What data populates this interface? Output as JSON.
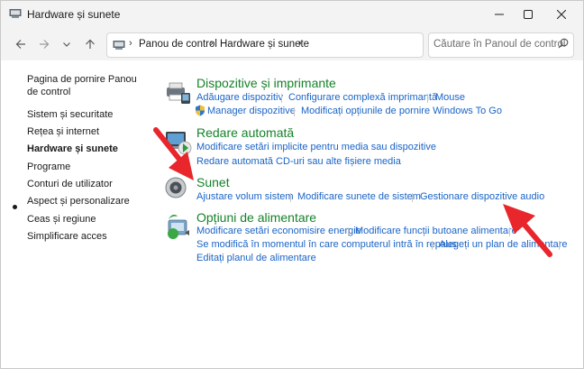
{
  "window": {
    "title": "Hardware și sunete"
  },
  "address": {
    "crumbs": [
      "Panou de control",
      "Hardware și sunete"
    ],
    "search_placeholder": "Căutare în Panoul de control"
  },
  "sidebar": {
    "items": [
      "Pagina de pornire Panou de control",
      "Sistem și securitate",
      "Rețea și internet",
      "Hardware și sunete",
      "Programe",
      "Conturi de utilizator",
      "Aspect și personalizare",
      "Ceas și regiune",
      "Simplificare acces"
    ],
    "active_index": 3
  },
  "categories": [
    {
      "title": "Dispozitive și imprimante",
      "links": [
        "Adăugare dispozitiv",
        "Configurare complexă imprimantă",
        "Mouse",
        "Manager dispozitive",
        "Modificați opțiunile de pornire Windows To Go"
      ]
    },
    {
      "title": "Redare automată",
      "links": [
        "Modificare setări implicite pentru media sau dispozitive",
        "Redare automată CD-uri sau alte fișiere media"
      ]
    },
    {
      "title": "Sunet",
      "links": [
        "Ajustare volum sistem",
        "Modificare sunete de sistem",
        "Gestionare dispozitive audio"
      ]
    },
    {
      "title": "Opțiuni de alimentare",
      "links": [
        "Modificare setări economisire energie",
        "Modificare funcții butoane alimentare",
        "Se modifică în momentul în care computerul intră în repaus",
        "Alegeți un plan de alimentare",
        "Editați planul de alimentare"
      ]
    }
  ],
  "colors": {
    "category_title": "#16822a",
    "link": "#1a64c6",
    "annotation_arrow": "#e8262c"
  }
}
